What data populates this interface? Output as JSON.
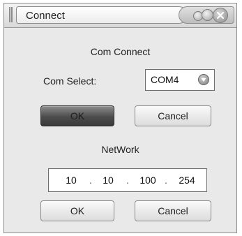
{
  "window": {
    "title": "Connect"
  },
  "com_section": {
    "heading": "Com Connect",
    "select_label": "Com Select:",
    "selected_port": "COM4",
    "ok_label": "OK",
    "cancel_label": "Cancel"
  },
  "network_section": {
    "heading": "NetWork",
    "ip_octets": [
      "10",
      "10",
      "100",
      "254"
    ],
    "separator": ".",
    "ok_label": "OK",
    "cancel_label": "Cancel"
  },
  "icons": {
    "window_grip": "grip-icon",
    "title_orbs": [
      "minimize-orb-icon",
      "maximize-orb-icon",
      "close-icon"
    ],
    "combo_arrow": "chevron-down-icon"
  },
  "colors": {
    "window_bg": "#e9e9e9",
    "default_button": "#4c4c4c",
    "field_bg": "#ffffff"
  }
}
